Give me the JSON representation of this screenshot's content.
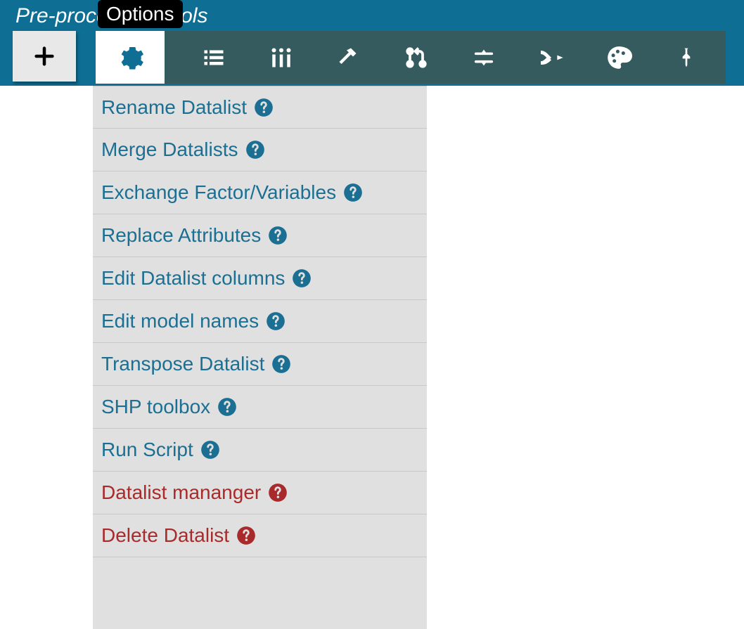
{
  "header": {
    "title": "Pre-processing tools",
    "tooltip": "Options"
  },
  "toolbar": {
    "plus": "plus",
    "gear": "gear",
    "items": [
      {
        "name": "list"
      },
      {
        "name": "columns"
      },
      {
        "name": "hammer"
      },
      {
        "name": "pull-request"
      },
      {
        "name": "slider"
      },
      {
        "name": "arrow-merge"
      },
      {
        "name": "palette"
      },
      {
        "name": "pin"
      }
    ]
  },
  "menu": {
    "items": [
      {
        "label": "Rename Datalist",
        "danger": false
      },
      {
        "label": "Merge Datalists",
        "danger": false
      },
      {
        "label": "Exchange Factor/Variables",
        "danger": false
      },
      {
        "label": "Replace Attributes",
        "danger": false
      },
      {
        "label": "Edit Datalist columns",
        "danger": false
      },
      {
        "label": "Edit model names",
        "danger": false
      },
      {
        "label": "Transpose Datalist",
        "danger": false
      },
      {
        "label": "SHP toolbox",
        "danger": false
      },
      {
        "label": "Run Script",
        "danger": false
      },
      {
        "label": "Datalist mananger",
        "danger": true
      },
      {
        "label": "Delete Datalist",
        "danger": true
      }
    ]
  },
  "colors": {
    "header_bg": "#0e6e93",
    "dark_toolbar_bg": "#365b5f",
    "panel_bg": "#e0e0e0",
    "link": "#1b6f92",
    "danger": "#a92a2a"
  }
}
